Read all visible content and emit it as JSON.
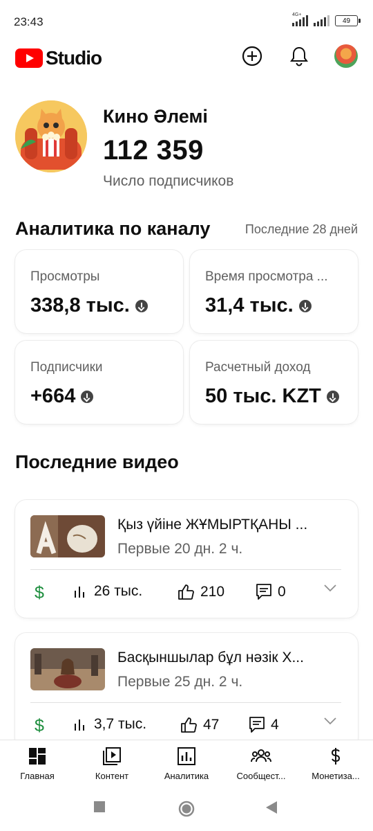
{
  "status_bar": {
    "time": "23:43",
    "network": "4G+",
    "battery": "49"
  },
  "app_bar": {
    "logo_text": "Studio",
    "icons": [
      "create-icon",
      "bell-icon",
      "avatar"
    ]
  },
  "channel": {
    "name": "Кино Әлемі",
    "subscribers": "112 359",
    "subscribers_label": "Число подписчиков"
  },
  "analytics": {
    "title": "Аналитика по каналу",
    "period": "Последние 28 дней",
    "cards": [
      {
        "label": "Просмотры",
        "value": "338,8 тыс."
      },
      {
        "label": "Время просмотра ...",
        "value": "31,4 тыс."
      },
      {
        "label": "Подписчики",
        "value": "+664"
      },
      {
        "label": "Расчетный доход",
        "value": "50 тыс. KZT"
      }
    ]
  },
  "recent_videos": {
    "title": "Последние видео",
    "items": [
      {
        "title": "Қыз үйіне ЖҰМЫРТҚАНЫ ...",
        "meta": "Первые 20 дн. 2 ч.",
        "views": "26 тыс.",
        "likes": "210",
        "comments": "0"
      },
      {
        "title": "Басқыншылар бұл нәзік Х...",
        "meta": "Первые 25 дн. 2 ч.",
        "views": "3,7 тыс.",
        "likes": "47",
        "comments": "4"
      }
    ]
  },
  "bottom_nav": [
    {
      "label": "Главная",
      "icon": "dashboard-icon"
    },
    {
      "label": "Контент",
      "icon": "content-icon"
    },
    {
      "label": "Аналитика",
      "icon": "analytics-icon"
    },
    {
      "label": "Сообщест...",
      "icon": "community-icon"
    },
    {
      "label": "Монетиза...",
      "icon": "monetization-icon"
    }
  ],
  "colors": {
    "youtube_red": "#ff0000",
    "monetization_green": "#1e8e3e",
    "secondary_text": "#606060"
  }
}
